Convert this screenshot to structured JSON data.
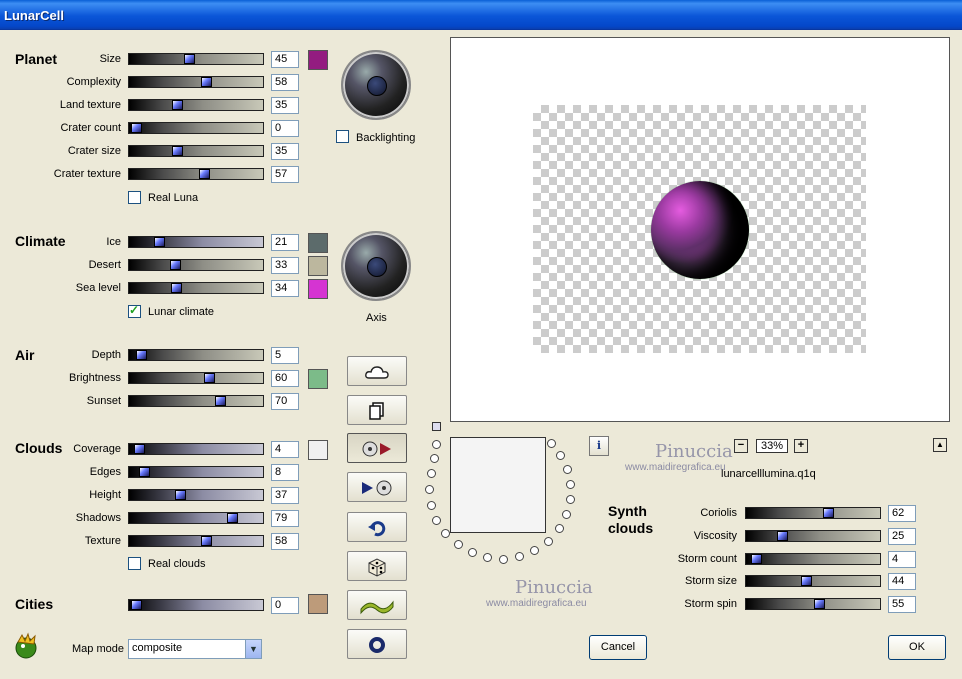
{
  "window": {
    "title": "LunarCell"
  },
  "planet": {
    "heading": "Planet",
    "rows": [
      {
        "label": "Size",
        "value": "45"
      },
      {
        "label": "Complexity",
        "value": "58"
      },
      {
        "label": "Land texture",
        "value": "35"
      },
      {
        "label": "Crater count",
        "value": "0"
      },
      {
        "label": "Crater size",
        "value": "35"
      },
      {
        "label": "Crater texture",
        "value": "57"
      }
    ],
    "color": "#931c80",
    "real_luna_label": "Real Luna",
    "backlighting_label": "Backlighting"
  },
  "climate": {
    "heading": "Climate",
    "rows": [
      {
        "label": "Ice",
        "value": "21"
      },
      {
        "label": "Desert",
        "value": "33"
      },
      {
        "label": "Sea level",
        "value": "34"
      }
    ],
    "colors": [
      "#5c6b6b",
      "#bcb79e",
      "#d534d2"
    ],
    "lunar_climate_label": "Lunar climate",
    "axis_label": "Axis"
  },
  "air": {
    "heading": "Air",
    "rows": [
      {
        "label": "Depth",
        "value": "5"
      },
      {
        "label": "Brightness",
        "value": "60"
      },
      {
        "label": "Sunset",
        "value": "70"
      }
    ],
    "color": "#7cbb89"
  },
  "clouds": {
    "heading": "Clouds",
    "rows": [
      {
        "label": "Coverage",
        "value": "4"
      },
      {
        "label": "Edges",
        "value": "8"
      },
      {
        "label": "Height",
        "value": "37"
      },
      {
        "label": "Shadows",
        "value": "79"
      },
      {
        "label": "Texture",
        "value": "58"
      }
    ],
    "color": "#f1f1f1",
    "real_clouds_label": "Real clouds"
  },
  "cities": {
    "heading": "Cities",
    "value": "0",
    "color": "#bd9b7a"
  },
  "map_mode": {
    "label": "Map mode",
    "value": "composite"
  },
  "preview": {
    "zoom_minus": "−",
    "zoom_value": "33%",
    "zoom_plus": "+",
    "collapse": "▲",
    "filename": "lunarcelllumina.q1q",
    "info": "i"
  },
  "synth_clouds": {
    "heading_line1": "Synth",
    "heading_line2": "clouds",
    "rows": [
      {
        "label": "Coriolis",
        "value": "62"
      },
      {
        "label": "Viscosity",
        "value": "25"
      },
      {
        "label": "Storm count",
        "value": "4"
      },
      {
        "label": "Storm size",
        "value": "44"
      },
      {
        "label": "Storm spin",
        "value": "55"
      }
    ]
  },
  "watermark": {
    "name": "Pinuccia",
    "url": "www.maidiregrafica.eu"
  },
  "buttons": {
    "cancel": "Cancel",
    "ok": "OK"
  }
}
